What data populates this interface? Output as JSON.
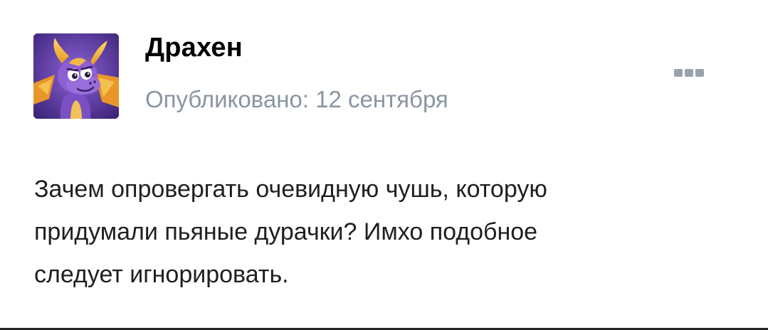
{
  "post": {
    "author": "Драхен",
    "published": "Опубликовано: 12 сентября",
    "text_lines": [
      "Зачем опровергать очевидную чушь, которую",
      "придумали пьяные дурачки? Имхо подобное",
      "следует игнорировать."
    ]
  },
  "avatar": {
    "icon": "purple-dragon-avatar-icon"
  },
  "menu": {
    "icon": "more-dots-icon"
  },
  "colors": {
    "date_text": "#8a95a3",
    "more_dots": "#99a3b0",
    "avatar_bg": "#5b3a9e"
  }
}
